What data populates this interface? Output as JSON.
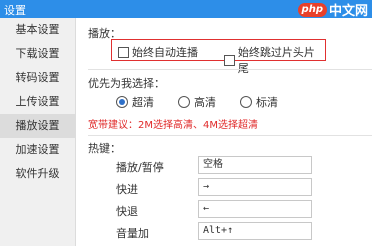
{
  "window": {
    "title": "设置"
  },
  "watermark": {
    "logo": "php",
    "text": "中文网"
  },
  "sidebar": {
    "items": [
      {
        "label": "基本设置"
      },
      {
        "label": "下载设置"
      },
      {
        "label": "转码设置"
      },
      {
        "label": "上传设置"
      },
      {
        "label": "播放设置",
        "active": true
      },
      {
        "label": "加速设置"
      },
      {
        "label": "软件升级"
      }
    ]
  },
  "playback": {
    "section_label": "播放：",
    "autoplay_label": "始终自动连播",
    "skip_label": "始终跳过片头片尾"
  },
  "priority": {
    "section_label": "优先为我选择：",
    "options": [
      "超清",
      "高清",
      "标清"
    ],
    "selected": "超清",
    "hint": "宽带建议：2M选择高清、4M选择超清"
  },
  "hotkeys": {
    "section_label": "热键：",
    "rows": [
      {
        "label": "播放/暂停",
        "value": "空格"
      },
      {
        "label": "快进",
        "value": "→"
      },
      {
        "label": "快退",
        "value": "←"
      },
      {
        "label": "音量加",
        "value": "Alt+↑"
      }
    ]
  }
}
